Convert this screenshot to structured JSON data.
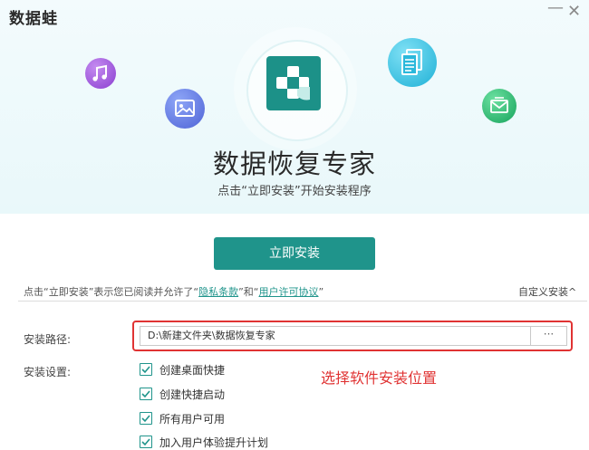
{
  "window": {
    "app_title": "数据蛙",
    "minimize_symbol": "—",
    "close_symbol": "✕"
  },
  "hero": {
    "product_name": "数据恢复专家",
    "subtitle": "点击“立即安装”开始安装程序",
    "icons": [
      "music-icon",
      "image-icon",
      "document-icon",
      "mail-icon",
      "app-logo-plus-icon"
    ],
    "colors": {
      "accent": "#1f948b",
      "music": "#8b3fd0",
      "image": "#4e63d6",
      "document": "#1fb1d6",
      "mail": "#17a35c"
    }
  },
  "install": {
    "button_label": "立即安装",
    "agreement_prefix": "点击“立即安装”表示您已阅读并允许了“",
    "privacy_link": "隐私条款",
    "agreement_middle": "”和“",
    "license_link": "用户许可协议",
    "agreement_suffix": "”",
    "custom_install_label": "自定义安装^"
  },
  "settings": {
    "path_label": "安装路径:",
    "path_value": "D:\\新建文件夹\\数据恢复专家",
    "browse_label": "···",
    "settings_label": "安装设置:",
    "options": [
      {
        "label": "创建桌面快捷",
        "checked": true
      },
      {
        "label": "创建快捷启动",
        "checked": true
      },
      {
        "label": "所有用户可用",
        "checked": true
      },
      {
        "label": "加入用户体验提升计划",
        "checked": true
      }
    ]
  },
  "annotation": {
    "text": "选择软件安装位置",
    "color": "#e03333"
  }
}
